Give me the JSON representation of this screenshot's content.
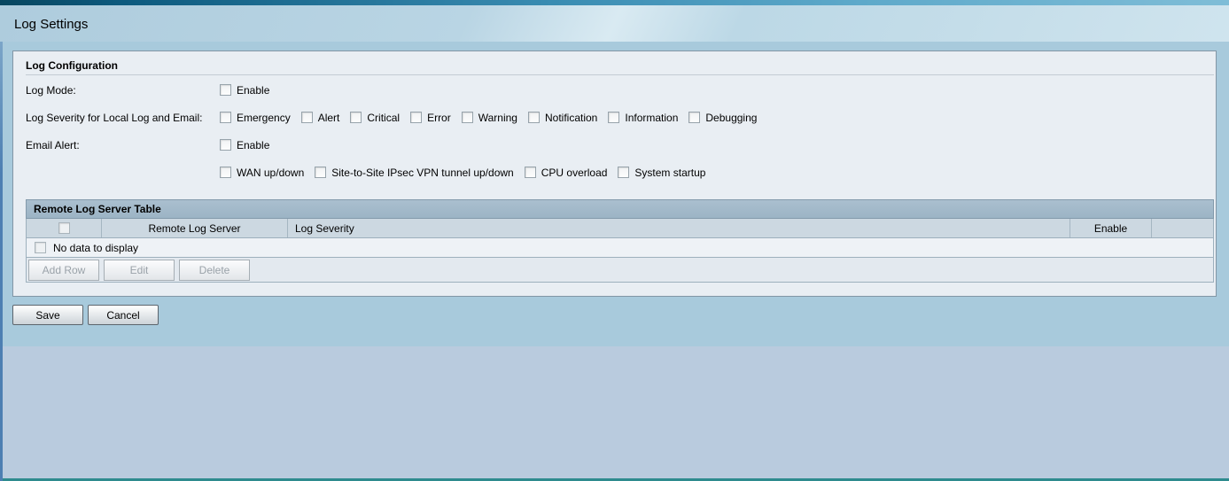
{
  "page": {
    "title": "Log Settings"
  },
  "form": {
    "section_title": "Log Configuration",
    "rows": [
      {
        "label": "Log Mode:",
        "items": [
          {
            "label": "Enable",
            "checked": false
          }
        ]
      },
      {
        "label": "Log Severity for Local Log and Email:",
        "items": [
          {
            "label": "Emergency",
            "checked": false
          },
          {
            "label": "Alert",
            "checked": false
          },
          {
            "label": "Critical",
            "checked": false
          },
          {
            "label": "Error",
            "checked": false
          },
          {
            "label": "Warning",
            "checked": false
          },
          {
            "label": "Notification",
            "checked": false
          },
          {
            "label": "Information",
            "checked": false
          },
          {
            "label": "Debugging",
            "checked": false
          }
        ]
      },
      {
        "label": "Email Alert:",
        "items": [
          {
            "label": "Enable",
            "checked": false
          }
        ]
      },
      {
        "label": "",
        "items": [
          {
            "label": "WAN up/down",
            "checked": false
          },
          {
            "label": "Site-to-Site IPsec VPN tunnel up/down",
            "checked": false
          },
          {
            "label": "CPU overload",
            "checked": false
          },
          {
            "label": "System startup",
            "checked": false
          }
        ]
      }
    ]
  },
  "table": {
    "title": "Remote Log Server Table",
    "columns": {
      "select": "",
      "server": "Remote Log Server",
      "severity": "Log Severity",
      "enable": "Enable",
      "actions": ""
    },
    "empty_text": "No data to display",
    "buttons": {
      "add": "Add Row",
      "edit": "Edit",
      "delete": "Delete"
    },
    "buttons_enabled": false
  },
  "actions": {
    "save": "Save",
    "cancel": "Cancel"
  },
  "colors": {
    "accent_bar_left": "#0d5a7e",
    "accent_bar_right": "#7fbdd7",
    "content_bg": "#a8cadc",
    "lower_bg": "#b9cbde",
    "panel_bg": "#e9eef3",
    "table_title_bg": "#a2b9c9",
    "bottom_line": "#2e8b8e"
  }
}
